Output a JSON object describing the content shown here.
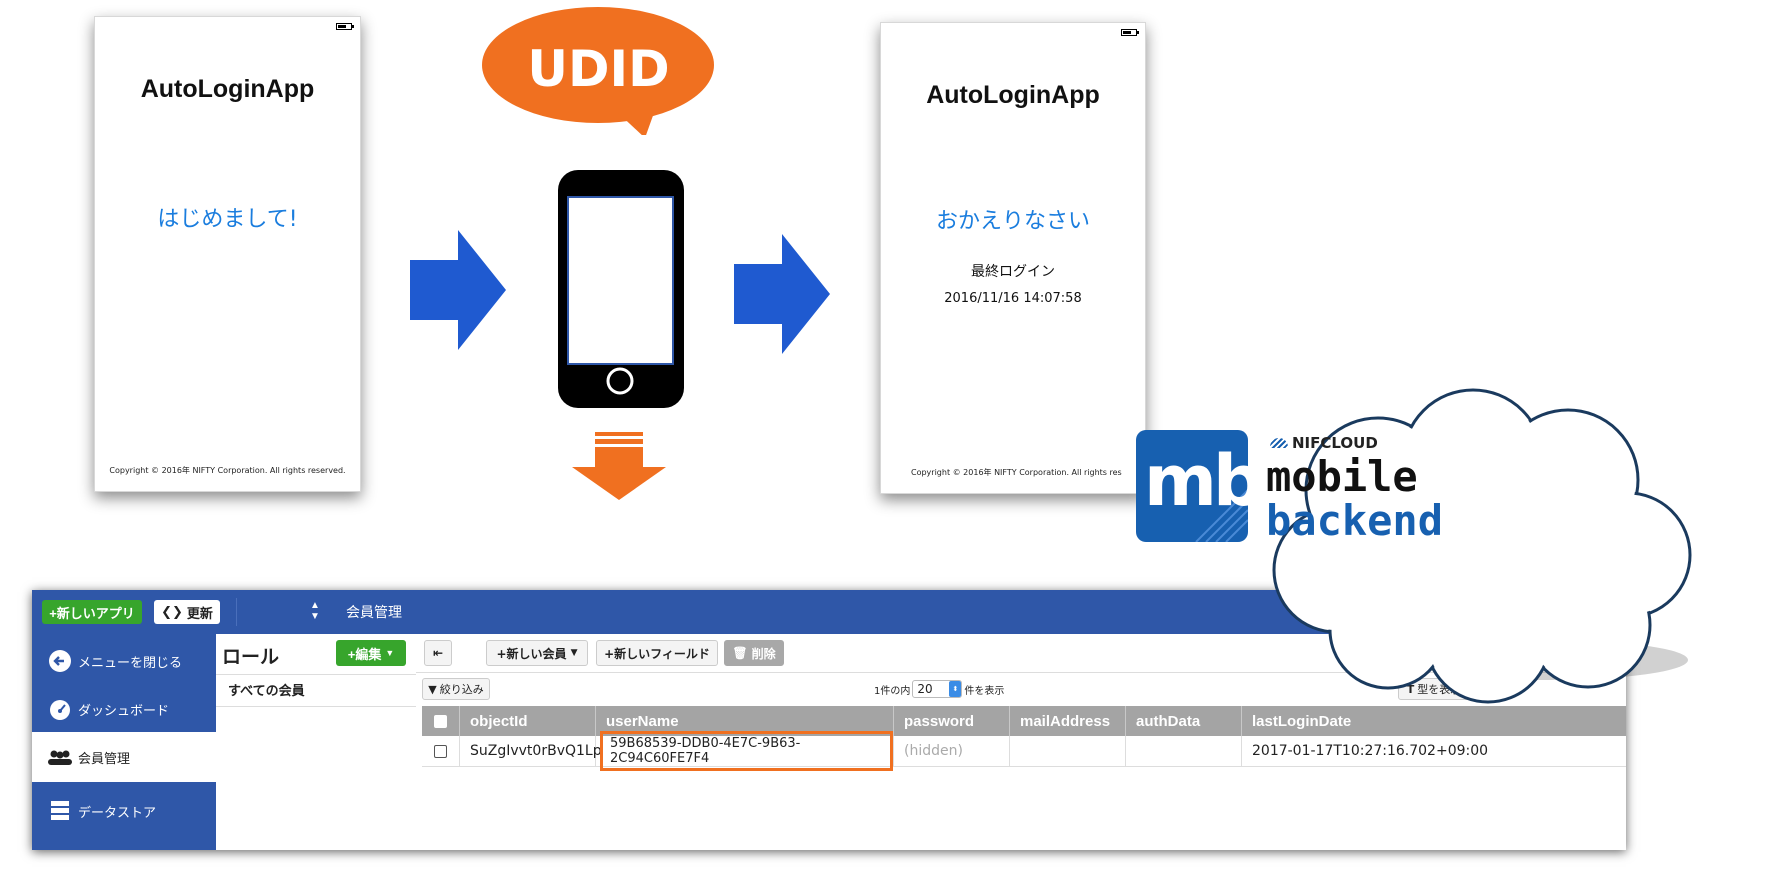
{
  "left_screen": {
    "app_title": "AutoLoginApp",
    "greeting": "はじめまして!",
    "copyright": "Copyright © 2016年 NIFTY Corporation. All rights reserved."
  },
  "bubble": {
    "label": "UDID"
  },
  "right_screen": {
    "app_title": "AutoLoginApp",
    "greeting": "おかえりなさい",
    "last_login_label": "最終ログイン",
    "last_login_value": "2016/11/16 14:07:58",
    "copyright": "Copyright © 2016年 NIFTY Corporation. All rights res"
  },
  "logo": {
    "mark": "mb",
    "brand": "NIFCLOUD",
    "line1": "mobile",
    "line2": "backend"
  },
  "dashboard": {
    "new_app_button": "+新しいアプリ",
    "refresh_button": "更新",
    "breadcrumb": "会員管理",
    "sidebar": {
      "items": [
        {
          "label": "メニューを閉じる",
          "icon": "arrow-left-circle-icon"
        },
        {
          "label": "ダッシュボード",
          "icon": "gauge-icon"
        },
        {
          "label": "会員管理",
          "icon": "users-icon"
        },
        {
          "label": "データストア",
          "icon": "database-icon"
        }
      ]
    },
    "role_pane": {
      "title": "ロール",
      "edit_button": "+編集",
      "all_members": "すべての会員"
    },
    "toolbar": {
      "new_member": "+新しい会員",
      "new_field": "+新しいフィールド",
      "delete": "削除",
      "filter": "絞り込み",
      "page_prefix": "1件の内",
      "page_size": "20",
      "page_suffix": "件を表示",
      "type_display": "型を表示"
    },
    "table": {
      "columns": [
        "objectId",
        "userName",
        "password",
        "mailAddress",
        "authData",
        "lastLoginDate"
      ],
      "rows": [
        {
          "objectId": "SuZgIvvt0rBvQ1Lp",
          "userName": "59B68539-DDB0-4E7C-9B63-2C94C60FE7F4",
          "password": "(hidden)",
          "mailAddress": "",
          "authData": "",
          "lastLoginDate": "2017-01-17T10:27:16.702+09:00"
        }
      ]
    }
  },
  "colors": {
    "accent_blue": "#1f5ad0",
    "orange": "#f07020",
    "nav_blue": "#2f57a8",
    "green": "#37a52c",
    "link_blue": "#1a7dde"
  }
}
